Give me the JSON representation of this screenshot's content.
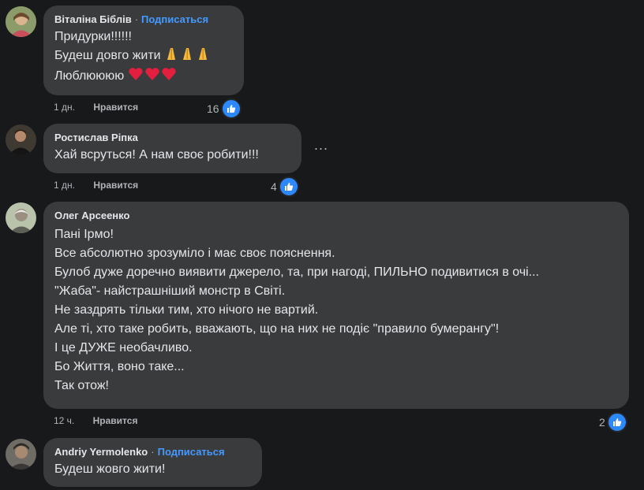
{
  "comments": [
    {
      "author": "Віталіна Біблів",
      "separator": "·",
      "subscribe": "Подписаться",
      "lines": [
        "Придурки!!!!!!",
        "Будеш довго жити",
        "Люблюююю"
      ],
      "time": "1 дн.",
      "like_action": "Нравится",
      "reaction_count": "16"
    },
    {
      "author": "Ростислав Ріпка",
      "lines": [
        "Хай всруться! А нам своє робити!!!"
      ],
      "time": "1 дн.",
      "like_action": "Нравится",
      "reaction_count": "4",
      "more_icon": "..."
    },
    {
      "author": "Олег Арсеенко",
      "lines": [
        "Пані Ірмо!",
        "Все абсолютно зрозуміло і має своє пояснення.",
        "Булоб дуже доречно виявити джерело, та, при нагоді, ПИЛЬНО подивитися в очі...",
        "\"Жаба\"- найстрашніший монстр в Світі.",
        "Не заздрять тільки тим, хто нічого не вартий.",
        "Але ті, хто таке робить, вважають, що на них не подіє \"правило бумерангу\"!",
        "І це ДУЖЕ необачливо.",
        "Бо Життя, воно таке...",
        "Так отож!"
      ],
      "time": "12 ч.",
      "like_action": "Нравится",
      "reaction_count": "2"
    },
    {
      "author": "Andriy Yermolenko",
      "separator": "·",
      "subscribe": "Подписаться",
      "lines": [
        "Будеш жовго жити!"
      ]
    }
  ],
  "icons": {
    "like": "thumbs-up-icon",
    "pray": "folded-hands-emoji",
    "heart": "red-heart-emoji"
  },
  "colors": {
    "background": "#18191a",
    "bubble": "#3a3b3c",
    "link_blue": "#4599ff",
    "like_blue": "#2d88ff",
    "heart_red": "#e41e3f"
  }
}
